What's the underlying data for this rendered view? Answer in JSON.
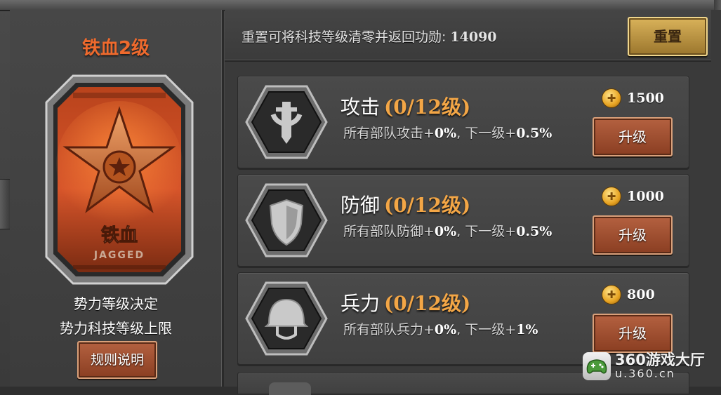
{
  "left": {
    "rank_title": "铁血2级",
    "badge": {
      "text_cn": "铁血",
      "text_en": "JAGGED"
    },
    "desc_line1": "势力等级决定",
    "desc_line2": "势力科技等级上限",
    "rules_button": "规则说明"
  },
  "top": {
    "reset_text": "重置可将科技等级清零并返回功勋:",
    "reset_value": "14090",
    "reset_button": "重置"
  },
  "techs": [
    {
      "name": "攻击",
      "level": "(0/12级)",
      "desc_prefix": "所有部队攻击+",
      "current": "0%",
      "desc_mid": ", 下一级+",
      "next": "0.5%",
      "cost": "1500",
      "button": "升级",
      "icon": "sword-icon"
    },
    {
      "name": "防御",
      "level": "(0/12级)",
      "desc_prefix": "所有部队防御+",
      "current": "0%",
      "desc_mid": ", 下一级+",
      "next": "0.5%",
      "cost": "1000",
      "button": "升级",
      "icon": "shield-icon"
    },
    {
      "name": "兵力",
      "level": "(0/12级)",
      "desc_prefix": "所有部队兵力+",
      "current": "0%",
      "desc_mid": ", 下一级+",
      "next": "1%",
      "cost": "800",
      "button": "升级",
      "icon": "helmet-icon"
    }
  ],
  "watermark": {
    "line1": "360游戏大厅",
    "line2": "u.360.cn"
  },
  "colors": {
    "accent_orange": "#ef6a2d",
    "level_gold": "#f3a646",
    "button_red": "#a0502f",
    "button_gold": "#c99a45"
  }
}
